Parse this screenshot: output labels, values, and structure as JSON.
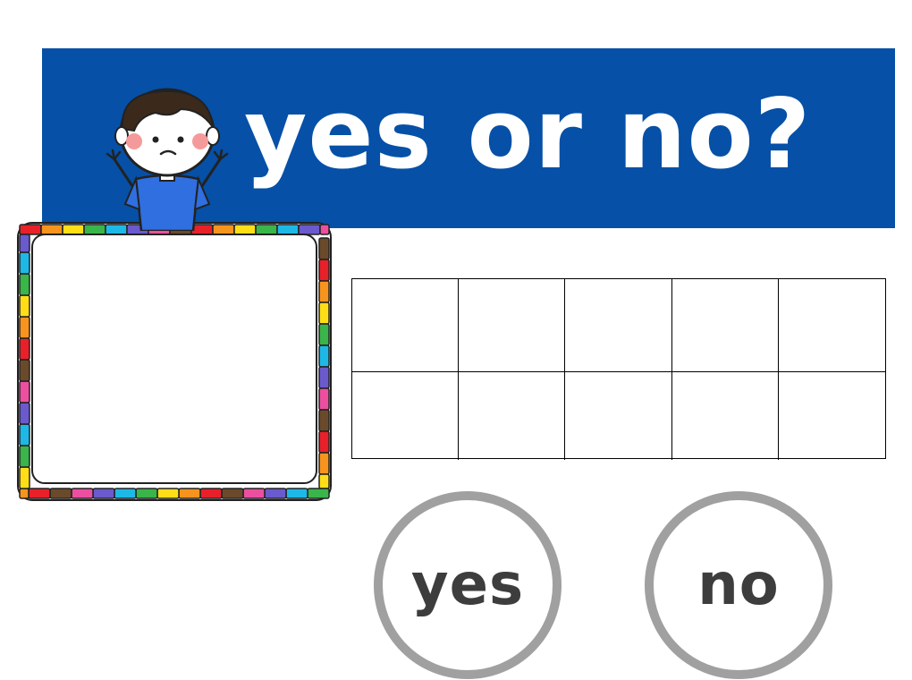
{
  "title": "yes or no?",
  "answers": {
    "yes_label": "yes",
    "no_label": "no"
  },
  "ten_frame": {
    "rows": 2,
    "columns": 5
  },
  "colors": {
    "banner": "#0650a7",
    "title_text": "#ffffff",
    "answer_ring": "#a0a0a0",
    "answer_text": "#3d3d3d",
    "frame_palette": [
      "#e8202a",
      "#f7941d",
      "#ffde17",
      "#39b54a",
      "#1eb8e6",
      "#6a5acd",
      "#ec4fa0",
      "#6b4a2b"
    ]
  },
  "icons": {
    "character": "boy-arms-raised-icon",
    "picture_frame": "rainbow-frame-icon"
  }
}
